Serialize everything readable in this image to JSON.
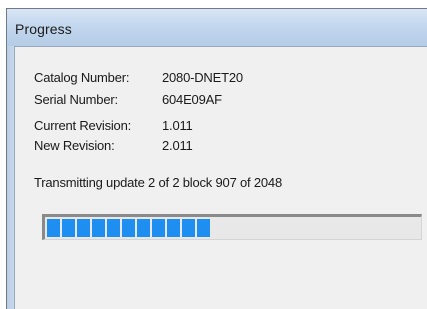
{
  "window": {
    "title": "Progress"
  },
  "info": [
    {
      "label": "Catalog Number:",
      "value": "2080-DNET20"
    },
    {
      "label": "Serial Number:",
      "value": "604E09AF"
    },
    {
      "label": "Current Revision:",
      "value": "1.011"
    },
    {
      "label": "New Revision:",
      "value": "2.011"
    }
  ],
  "status": {
    "text": "Transmitting update 2 of 2  block 907 of 2048"
  },
  "progress": {
    "value": 907,
    "max": 2048,
    "fraction": 0.443,
    "color": "#1e8ff0"
  }
}
